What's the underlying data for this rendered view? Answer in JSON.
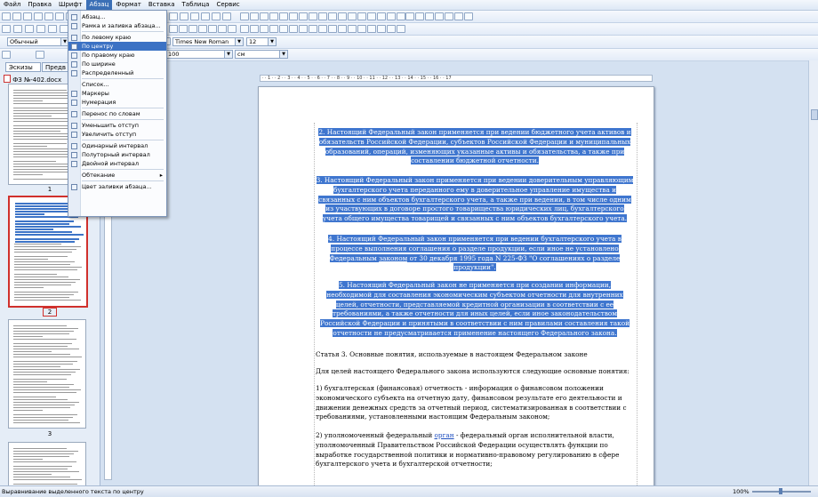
{
  "menubar": {
    "items": [
      "Файл",
      "Правка",
      "Шрифт",
      "Абзац",
      "Формат",
      "Вставка",
      "Таблица",
      "Сервис"
    ],
    "active": "Абзац"
  },
  "toolbar": {
    "style_value": "Обычный",
    "font_value": "Times New Roman",
    "size_value": "12",
    "zoom_value": "100",
    "zoom_unit_value": "см"
  },
  "menu": {
    "items": [
      {
        "label": "Абзац...",
        "icon": true
      },
      {
        "label": "Рамка и заливка абзаца...",
        "icon": true
      },
      {
        "sep": true
      },
      {
        "label": "По левому краю",
        "icon": true
      },
      {
        "label": "По центру",
        "icon": true,
        "highlighted": true
      },
      {
        "label": "По правому краю",
        "icon": true
      },
      {
        "label": "По ширине",
        "icon": true
      },
      {
        "label": "Распределенный",
        "icon": true
      },
      {
        "sep": true
      },
      {
        "label": "Список...",
        "icon": false
      },
      {
        "label": "Маркеры",
        "icon": true
      },
      {
        "label": "Нумерация",
        "icon": true
      },
      {
        "sep": true
      },
      {
        "label": "Перенос по словам",
        "icon": true
      },
      {
        "sep": true
      },
      {
        "label": "Уменьшить отступ",
        "icon": true
      },
      {
        "label": "Увеличить отступ",
        "icon": true
      },
      {
        "sep": true
      },
      {
        "label": "Одинарный интервал",
        "icon": true
      },
      {
        "label": "Полуторный интервал",
        "icon": true
      },
      {
        "label": "Двойной интервал",
        "icon": true
      },
      {
        "sep": true
      },
      {
        "label": "Обтекание",
        "icon": false,
        "submenu": "▸"
      },
      {
        "sep": true
      },
      {
        "label": "Цвет заливки абзаца...",
        "icon": true
      }
    ]
  },
  "leftpanel": {
    "tab1": "Эскизы",
    "tab2": "Предв",
    "file_name": "ФЗ №-402.docx",
    "pages": [
      "1",
      "2",
      "3"
    ]
  },
  "document": {
    "p2": "2. Настоящий Федеральный закон применяется при ведении бюджетного учета активов и обязательств Российской Федерации, субъектов Российской Федерации и муниципальных образований, операций, изменяющих указанные активы и обязательства, а также при составлении бюджетной отчетности.",
    "p3": "3. Настоящий Федеральный закон применяется при ведении доверительным управляющим бухгалтерского учета переданного ему в доверительное управление имущества и связанных с ним объектов бухгалтерского учета, а также при ведении, в том числе одним из участвующих в договоре простого товарищества юридических лиц, бухгалтерского учета общего имущества товарищей и связанных с ним объектов бухгалтерского учета.",
    "p4_a": "4. Настоящий Федеральный закон применяется при ведении бухгалтерского учета в процессе выполнения соглашения о разделе продукции, если иное не установлено Федеральным ",
    "p4_link": "законом",
    "p4_b": " от 30 декабря 1995 года N 225-ФЗ \"О соглашениях о разделе продукции\".",
    "p5": "5. Настоящий Федеральный закон не применяется при создании информации, необходимой для составления экономическим субъектом отчетности для внутренних целей, отчетности, представляемой кредитной организации в соответствии с ее требованиями, а также отчетности для иных целей, если иное законодательством Российской Федерации и принятыми в соответствии с ним правилами составления такой отчетности не предусматривается применение настоящего Федерального закона.",
    "art3": "Статья 3. Основные понятия, используемые в настоящем Федеральном законе",
    "intro": "Для целей настоящего Федерального закона используются следующие основные понятия:",
    "def1": "1) бухгалтерская (финансовая) отчетность - информация о финансовом положении экономического субъекта на отчетную дату, финансовом результате его деятельности и движении денежных средств за отчетный период, систематизированная в соответствии с требованиями, установленными настоящим Федеральным законом;",
    "def2_a": "2) уполномоченный федеральный ",
    "def2_link": "орган",
    "def2_b": " - федеральный орган исполнительной власти, уполномоченный Правительством Российской Федерации осуществлять функции по выработке государственной политики и нормативно-правовому регулированию в сфере бухгалтерского учета и бухгалтерской отчетности;"
  },
  "statusbar": {
    "text": "Выравнивание выделенного текста по центру",
    "zoom": "100%"
  }
}
